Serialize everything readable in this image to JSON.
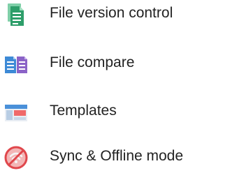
{
  "features": [
    {
      "label": "File version control",
      "icon": "file-version-icon",
      "color": "#2e9e6a"
    },
    {
      "label": "File compare",
      "icon": "file-compare-icon",
      "color": "#3d8ad6"
    },
    {
      "label": "Templates",
      "icon": "templates-icon",
      "color": "#4a90d9"
    },
    {
      "label": "Sync & Offline mode",
      "icon": "sync-offline-icon",
      "color": "#e0474c"
    }
  ]
}
